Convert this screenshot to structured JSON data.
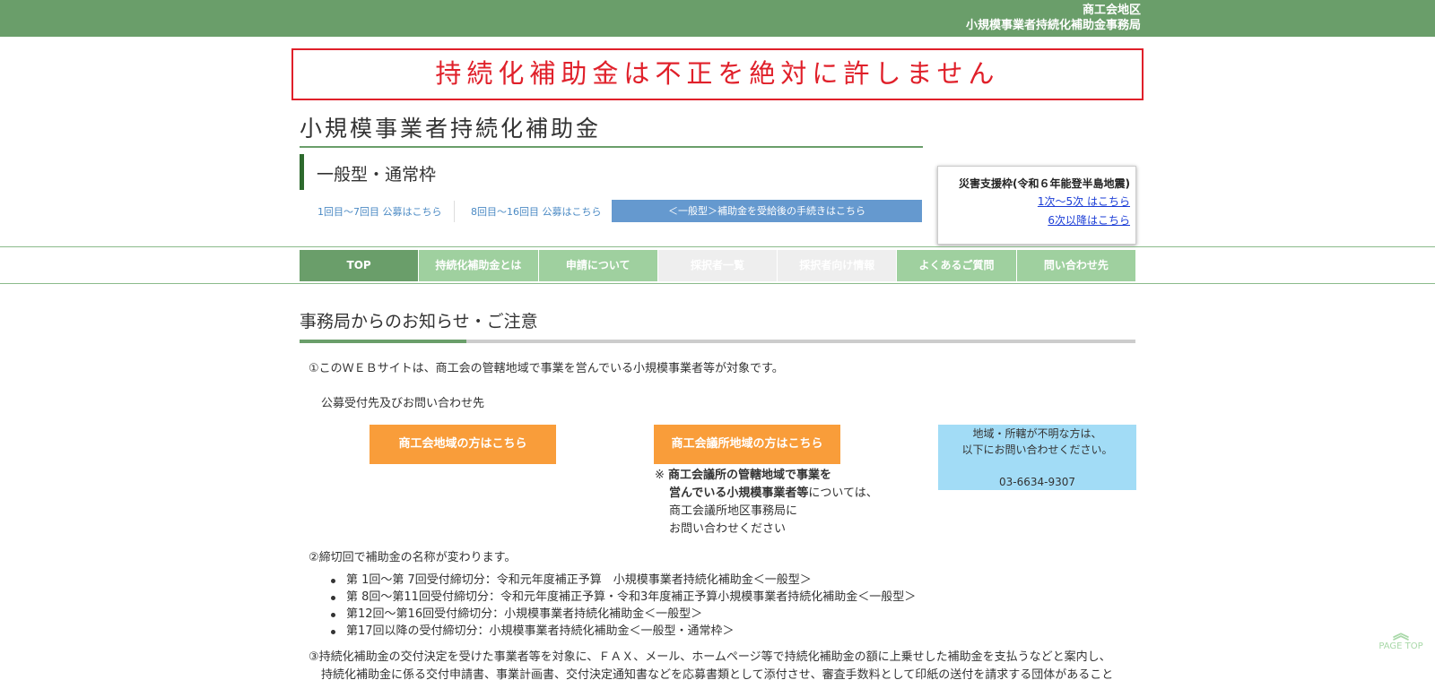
{
  "header": {
    "line1": "商工会地区",
    "line2": "小規模事業者持続化補助金事務局"
  },
  "banner": "持続化補助金は不正を絶対に許しません",
  "site_title": "小規模事業者持続化補助金",
  "sub_title": "一般型・通常枠",
  "links": {
    "round1": "1回目〜7回目 公募はこちら",
    "round2": "8回目〜16回目 公募はこちら",
    "procedure": "＜一般型＞補助金を受給後の手続きはこちら"
  },
  "disaster": {
    "title": "災害支援枠(令和６年能登半島地震)",
    "link1": "1次〜5次 はこちら",
    "link2": "6次以降はこちら"
  },
  "nav": [
    {
      "label": "TOP",
      "color": "#6a9e6a"
    },
    {
      "label": "持続化補助金とは",
      "color": "#9fd09f"
    },
    {
      "label": "申請について",
      "color": "#9fd09f"
    },
    {
      "label": "採択者一覧",
      "color": "#eeeeee"
    },
    {
      "label": "採択者向け情報",
      "color": "#eeeeee"
    },
    {
      "label": "よくあるご質問",
      "color": "#9fd09f"
    },
    {
      "label": "問い合わせ先",
      "color": "#9fd09f"
    }
  ],
  "section_title": "事務局からのお知らせ・ご注意",
  "notice1": "①このＷＥＢサイトは、商工会の管轄地域で事業を営んでいる小規模事業者等が対象です。",
  "contact_heading": "公募受付先及びお問い合わせ先",
  "btn_shokokai": "商工会地域の方はこちら",
  "btn_kaigisho": "商工会議所地域の方はこちら",
  "note": {
    "prefix": "※",
    "bold1": "商工会議所の管轄地域で事業を",
    "bold2": "営んでいる小規模事業者等",
    "rest1": "については、",
    "line3": "商工会議所地区事務局に",
    "line4": "お問い合わせください"
  },
  "unknown_box": {
    "line1": "地域・所轄が不明な方は、",
    "line2": "以下にお問い合わせください。",
    "phone": "03-6634-9307"
  },
  "notice2": "②締切回で補助金の名称が変わります。",
  "rounds": [
    "第  1回〜第  7回受付締切分：令和元年度補正予算　小規模事業者持続化補助金＜一般型＞",
    "第  8回〜第11回受付締切分：令和元年度補正予算・令和3年度補正予算小規模事業者持続化補助金＜一般型＞",
    "第12回〜第16回受付締切分：小規模事業者持続化補助金＜一般型＞",
    "第17回以降の受付締切分：小規模事業者持続化補助金＜一般型・通常枠＞"
  ],
  "notice3_line1": "③持続化補助金の交付決定を受けた事業者等を対象に、ＦＡＸ、メール、ホームページ等で持続化補助金の額に上乗せした補助金を支払うなどと案内し、",
  "notice3_line2": "持続化補助金に係る交付申請書、事業計画書、交付決定通知書などを応募書類として添付させ、審査手数料として印紙の送付を請求する団体があること",
  "pagetop": "PAGE TOP"
}
